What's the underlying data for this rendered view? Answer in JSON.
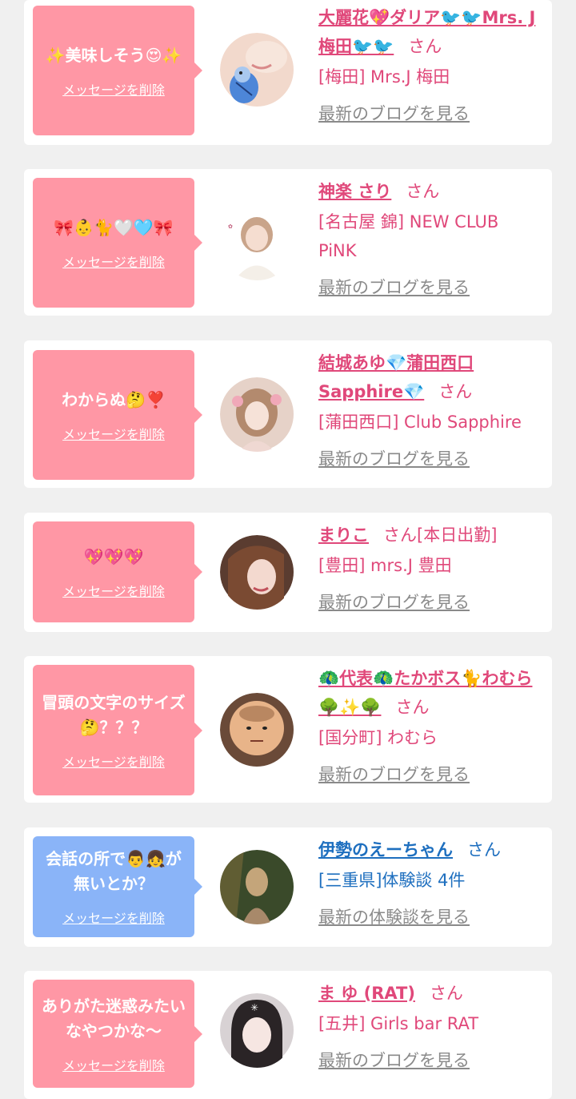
{
  "entries": [
    {
      "bubble_color": "pink",
      "message": "✨美味しそう😍✨",
      "delete_label": "メッセージを削除",
      "name": "大麗花💖ダリア🐦🐦Mrs. J 梅田🐦🐦",
      "suffix": "さん",
      "shop": "[梅田] Mrs.J 梅田",
      "blog_link": "最新のブログを見る",
      "avatar_icon": "avatar-parakeet-icon"
    },
    {
      "bubble_color": "pink",
      "message": "🎀👶🐈🤍🩵🎀",
      "delete_label": "メッセージを削除",
      "name": "神楽 さり",
      "suffix": "さん",
      "shop": "[名古屋 錦] NEW CLUB PiNK",
      "blog_link": "最新のブログを見る",
      "avatar_icon": "avatar-woman-icon"
    },
    {
      "bubble_color": "pink",
      "message": "わからぬ🤔❣️",
      "delete_label": "メッセージを削除",
      "name": "結城あゆ💎蒲田西口Sapphire💎",
      "suffix": "さん",
      "shop": "[蒲田西口] Club Sapphire",
      "blog_link": "最新のブログを見る",
      "avatar_icon": "avatar-woman-flowers-icon"
    },
    {
      "bubble_color": "pink",
      "message": "💖💖💖",
      "delete_label": "メッセージを削除",
      "name": "まりこ",
      "suffix": "さん[本日出勤]",
      "shop": "[豊田] mrs.J 豊田",
      "blog_link": "最新のブログを見る",
      "avatar_icon": "avatar-woman-brown-hair-icon"
    },
    {
      "bubble_color": "pink",
      "message": "冒頭の文字のサイズ🤔？？？",
      "delete_label": "メッセージを削除",
      "name": "🦚代表🦚たかボス🐈わむら🌳✨🌳",
      "suffix": "さん",
      "shop": "[国分町] わむら",
      "blog_link": "最新のブログを見る",
      "avatar_icon": "avatar-face-melon-icon"
    },
    {
      "bubble_color": "blue",
      "message": "会話の所で👨👧が無いとか？",
      "delete_label": "メッセージを削除",
      "name": "伊勢のえーちゃん",
      "suffix": "さん",
      "shop": "[三重県]体験談 4件",
      "blog_link": "最新の体験談を見る",
      "avatar_icon": "avatar-statue-icon"
    },
    {
      "bubble_color": "pink",
      "message": "ありがた迷惑みたいなやつかな〜",
      "delete_label": "メッセージを削除",
      "name": "ま ゆ (RAT)",
      "suffix": "さん",
      "shop": "[五井] Girls bar RAT",
      "blog_link": "最新のブログを見る",
      "avatar_icon": "avatar-woman-dark-hair-icon"
    }
  ]
}
